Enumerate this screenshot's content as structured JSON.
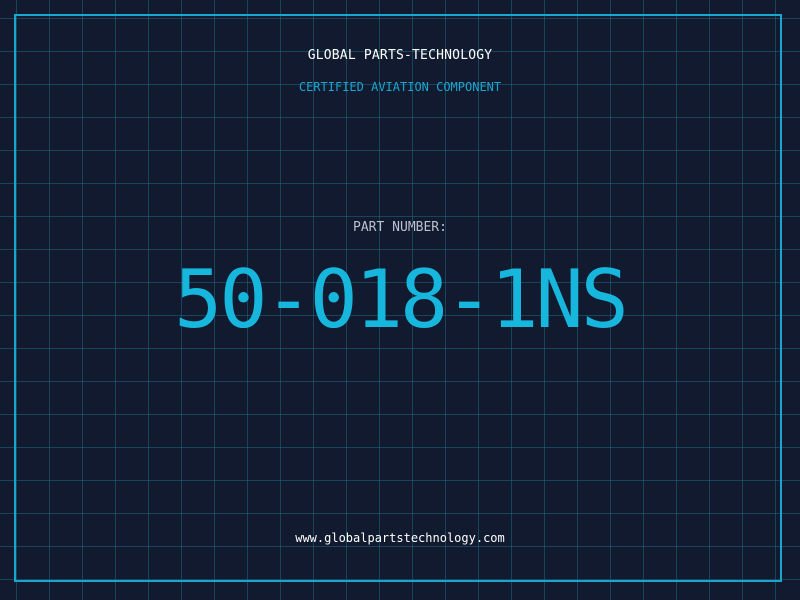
{
  "header": {
    "company": "GLOBAL PARTS-TECHNOLOGY",
    "subtitle": "CERTIFIED AVIATION COMPONENT"
  },
  "part": {
    "label": "PART NUMBER:",
    "number": "50-018-1NS"
  },
  "footer": {
    "website": "www.globalpartstechnology.com"
  },
  "colors": {
    "background": "#111a2e",
    "grid": "#22789a",
    "accent": "#17b6dd",
    "text": "#ffffff",
    "label": "#b9c2cf"
  }
}
